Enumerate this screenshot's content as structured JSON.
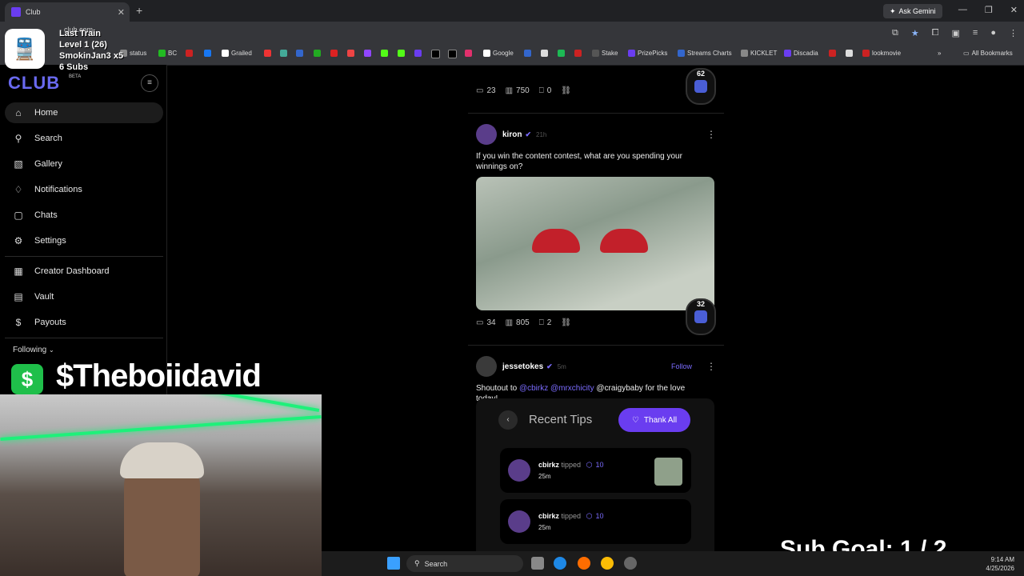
{
  "browser": {
    "tab_title": "Club",
    "url": "club.com",
    "ask_gemini": "Ask Gemini",
    "all_bookmarks": "All Bookmarks",
    "bookmarks": [
      "status",
      "BC",
      "Grailed",
      "Google",
      "Stake",
      "PrizePicks",
      "Streams Charts",
      "KICKLET",
      "Discadia",
      "lookmovie"
    ]
  },
  "sidebar": {
    "logo": "CLUB",
    "beta": "BETA",
    "items": [
      {
        "label": "Home",
        "icon": "home-icon"
      },
      {
        "label": "Search",
        "icon": "search-icon"
      },
      {
        "label": "Gallery",
        "icon": "gallery-icon"
      },
      {
        "label": "Notifications",
        "icon": "bell-icon"
      },
      {
        "label": "Chats",
        "icon": "chat-icon"
      },
      {
        "label": "Settings",
        "icon": "gear-icon"
      },
      {
        "label": "Creator Dashboard",
        "icon": "dashboard-icon"
      },
      {
        "label": "Vault",
        "icon": "vault-icon"
      },
      {
        "label": "Payouts",
        "icon": "dollar-icon"
      }
    ],
    "following_label": "Following"
  },
  "feed": {
    "post0": {
      "comments": "23",
      "views": "750",
      "saves": "0",
      "badge": "62"
    },
    "post1": {
      "user": "kiron",
      "time": "21h",
      "text": "If you win the content contest, what are you spending your winnings on?",
      "comments": "34",
      "views": "805",
      "saves": "2",
      "badge": "32"
    },
    "post2": {
      "user": "jessetokes",
      "time": "5m",
      "follow": "Follow",
      "text_prefix": "Shoutout to ",
      "mention1": "@cbirkz",
      "mention2": "@mrxchicity",
      "text_suffix": " @craigybaby for the love today!"
    },
    "tips": {
      "title": "Recent Tips",
      "thank_all": "Thank All",
      "items": [
        {
          "user": "cbirkz",
          "verb": "tipped",
          "amount": "10",
          "time": "25m"
        },
        {
          "user": "cbirkz",
          "verb": "tipped",
          "amount": "10",
          "time": "25m"
        }
      ]
    }
  },
  "overlay": {
    "train_title": "Last Train",
    "level": "Level 1  (26)",
    "subscriber": "SmokinJan3 x5",
    "subs": "6 Subs",
    "cashtag": "$Theboiidavid",
    "sub_goal": "Sub Goal:  1 / 2"
  },
  "taskbar": {
    "search": "Search",
    "time": "9:14 AM",
    "date": "4/25/2026"
  }
}
